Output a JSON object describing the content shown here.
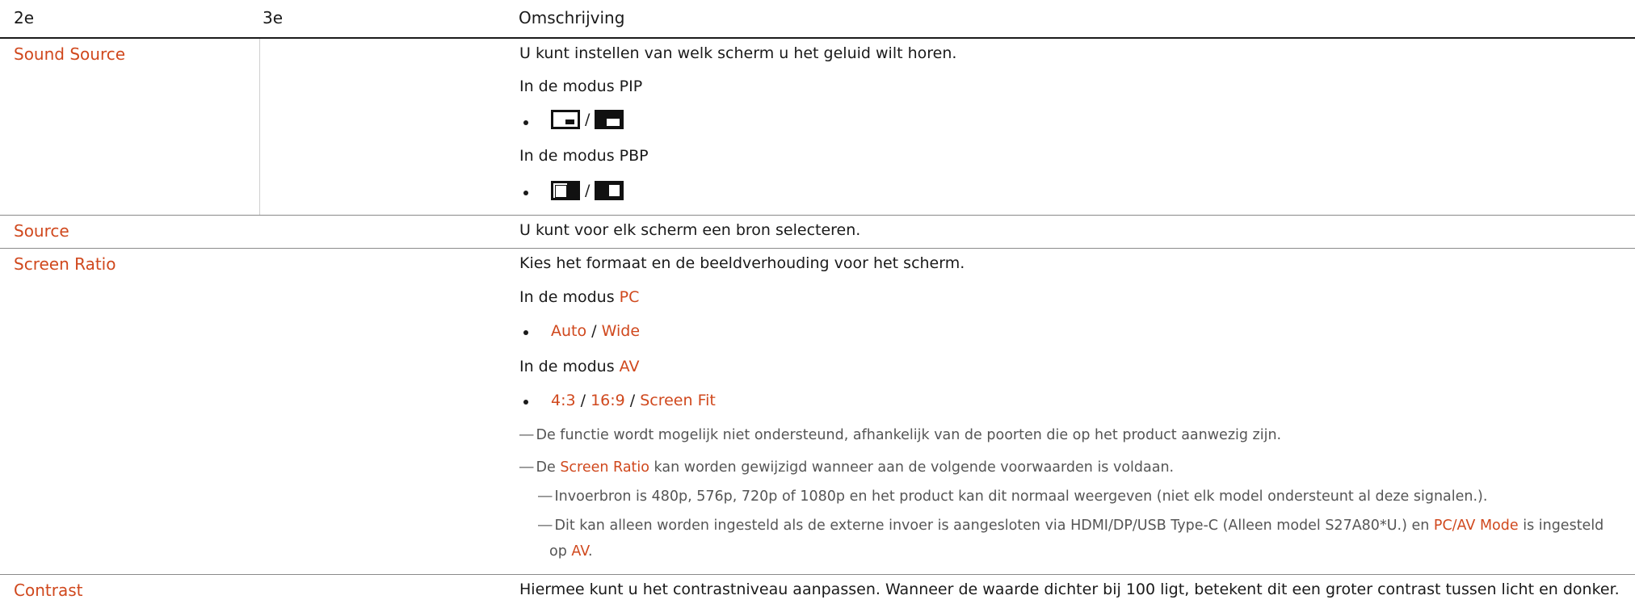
{
  "header": {
    "col1": "2e",
    "col2": "3e",
    "col3": "Omschrijving"
  },
  "rows": {
    "sound_source": {
      "label": "Sound Source",
      "desc": "U kunt instellen van welk scherm u het geluid wilt horen.",
      "pip_mode": "In de modus PIP",
      "pbp_mode": "In de modus PBP",
      "slash": "/"
    },
    "source": {
      "label": "Source",
      "desc": "U kunt voor elk scherm een bron selecteren."
    },
    "screen_ratio": {
      "label": "Screen Ratio",
      "desc": "Kies het formaat en de beeldverhouding voor het scherm.",
      "pc_prefix": "In de modus ",
      "pc": "PC",
      "pc_opt1": "Auto",
      "pc_opt2": "Wide",
      "av_prefix": "In de modus ",
      "av": "AV",
      "av_opt1": "4:3",
      "av_opt2": "16:9",
      "av_opt3": "Screen Fit",
      "slash": " / ",
      "dash": "―",
      "note1": "De functie wordt mogelijk niet ondersteund, afhankelijk van de poorten die op het product aanwezig zijn.",
      "note2_pre": "De ",
      "note2_term": "Screen Ratio",
      "note2_post": " kan worden gewijzigd wanneer aan de volgende voorwaarden is voldaan.",
      "note3": "Invoerbron is 480p, 576p, 720p of 1080p en het product kan dit normaal weergeven (niet elk model ondersteunt al deze signalen.).",
      "note4_pre": "Dit kan alleen worden ingesteld als de externe invoer is aangesloten via HDMI/DP/USB Type-C (Alleen model S27A80*U.) en ",
      "note4_term": "PC/AV Mode",
      "note4_post": " is ingesteld",
      "note4_line2_pre": "op ",
      "note4_line2_term": "AV",
      "note4_line2_post": "."
    },
    "contrast": {
      "label": "Contrast",
      "desc": "Hiermee kunt u het contrastniveau aanpassen. Wanneer de waarde dichter bij 100 ligt, betekent dit een groter contrast tussen licht en donker."
    }
  },
  "colors": {
    "accent": "#d0481d",
    "text": "#1a1a1a",
    "note": "#555555"
  }
}
